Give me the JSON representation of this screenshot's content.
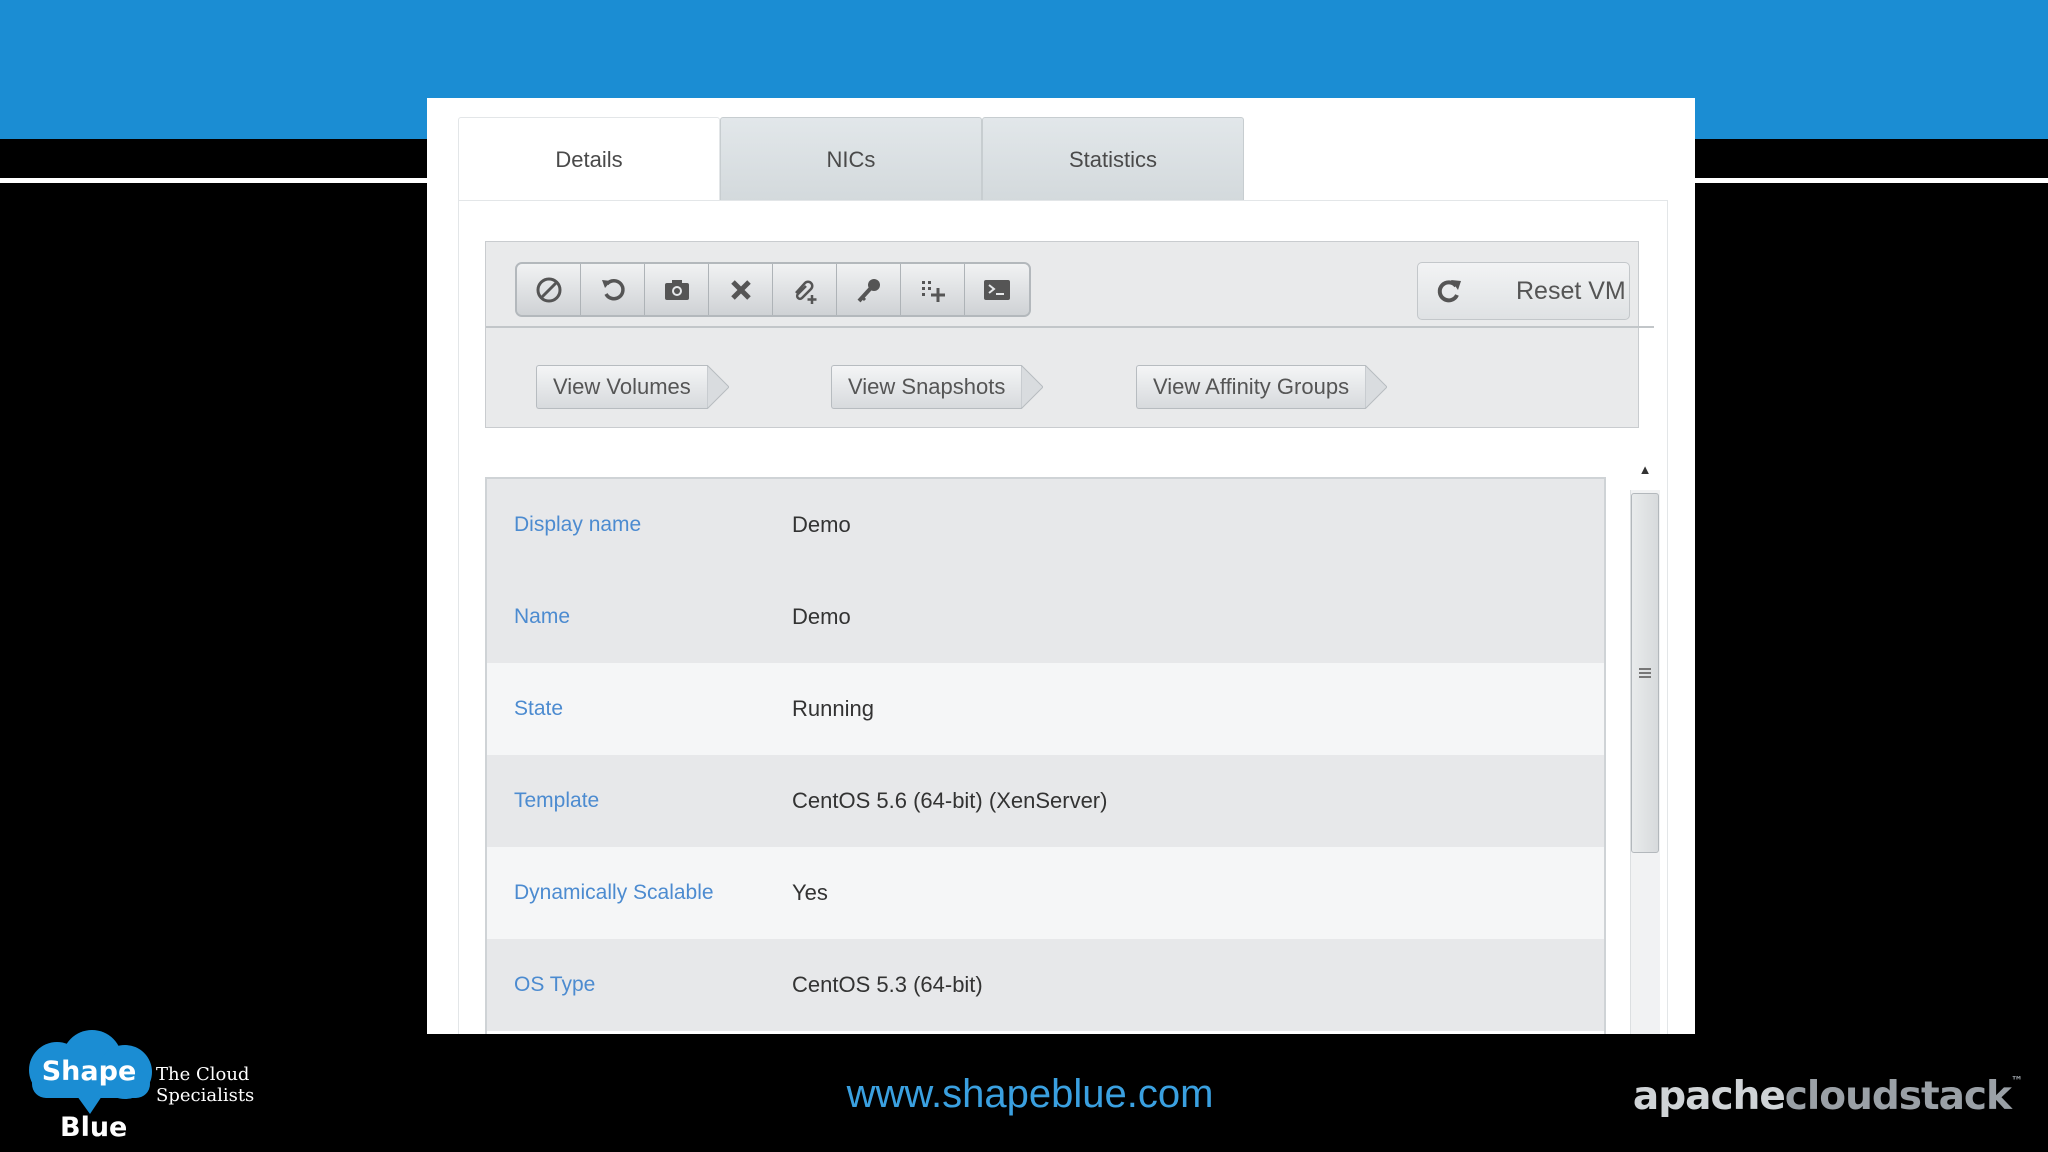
{
  "tabs": [
    "Details",
    "NICs",
    "Statistics"
  ],
  "active_tab": "Details",
  "toolbar": {
    "actions": [
      {
        "icon": "stop-icon"
      },
      {
        "icon": "reboot-icon"
      },
      {
        "icon": "snapshot-icon"
      },
      {
        "icon": "destroy-icon"
      },
      {
        "icon": "attach-iso-icon"
      },
      {
        "icon": "reset-password-icon"
      },
      {
        "icon": "change-service-offering-icon"
      },
      {
        "icon": "console-icon"
      }
    ],
    "reset_label": "Reset VM",
    "view_buttons": [
      "View Volumes",
      "View Snapshots",
      "View Affinity Groups"
    ]
  },
  "details": [
    {
      "key": "Display name",
      "value": "Demo"
    },
    {
      "key": "Name",
      "value": "Demo"
    },
    {
      "key": "State",
      "value": "Running"
    },
    {
      "key": "Template",
      "value": "CentOS 5.6 (64-bit) (XenServer)"
    },
    {
      "key": "Dynamically Scalable",
      "value": "Yes"
    },
    {
      "key": "OS Type",
      "value": "CentOS 5.3 (64-bit)"
    }
  ],
  "footer": {
    "logo_word1": "Shape",
    "logo_word2": "Blue",
    "logo_tagline": "The Cloud Specialists",
    "url": "www.shapeblue.com",
    "brand_part1": "apache",
    "brand_part2": "cloudstack",
    "brand_tm": "™"
  },
  "colors": {
    "header_blue": "#1b8dd3",
    "link_blue": "#4c8bd0",
    "url_blue": "#3aa0e0"
  }
}
